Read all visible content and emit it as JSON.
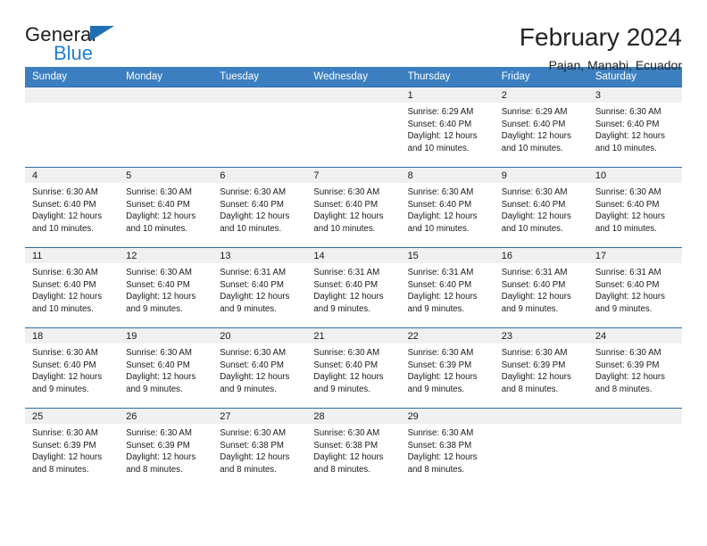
{
  "brand": {
    "name_part1": "General",
    "name_part2": "Blue",
    "triangle_color": "#1f6fb5",
    "blue_color": "#1f7fd0"
  },
  "header": {
    "title": "February 2024",
    "subtitle": "Pajan, Manabi, Ecuador"
  },
  "theme": {
    "header_row_bg": "#3c7fc1",
    "cell_border": "#2d6ca8",
    "daynum_band_bg": "#f0f0f0"
  },
  "weekdays": [
    "Sunday",
    "Monday",
    "Tuesday",
    "Wednesday",
    "Thursday",
    "Friday",
    "Saturday"
  ],
  "labels": {
    "sunrise_prefix": "Sunrise:",
    "sunset_prefix": "Sunset:",
    "daylight_prefix": "Daylight:"
  },
  "weeks": [
    [
      {
        "day": "",
        "empty": true
      },
      {
        "day": "",
        "empty": true
      },
      {
        "day": "",
        "empty": true
      },
      {
        "day": "",
        "empty": true
      },
      {
        "day": "1",
        "sunrise": "Sunrise: 6:29 AM",
        "sunset": "Sunset: 6:40 PM",
        "daylight1": "Daylight: 12 hours",
        "daylight2": "and 10 minutes."
      },
      {
        "day": "2",
        "sunrise": "Sunrise: 6:29 AM",
        "sunset": "Sunset: 6:40 PM",
        "daylight1": "Daylight: 12 hours",
        "daylight2": "and 10 minutes."
      },
      {
        "day": "3",
        "sunrise": "Sunrise: 6:30 AM",
        "sunset": "Sunset: 6:40 PM",
        "daylight1": "Daylight: 12 hours",
        "daylight2": "and 10 minutes."
      }
    ],
    [
      {
        "day": "4",
        "sunrise": "Sunrise: 6:30 AM",
        "sunset": "Sunset: 6:40 PM",
        "daylight1": "Daylight: 12 hours",
        "daylight2": "and 10 minutes."
      },
      {
        "day": "5",
        "sunrise": "Sunrise: 6:30 AM",
        "sunset": "Sunset: 6:40 PM",
        "daylight1": "Daylight: 12 hours",
        "daylight2": "and 10 minutes."
      },
      {
        "day": "6",
        "sunrise": "Sunrise: 6:30 AM",
        "sunset": "Sunset: 6:40 PM",
        "daylight1": "Daylight: 12 hours",
        "daylight2": "and 10 minutes."
      },
      {
        "day": "7",
        "sunrise": "Sunrise: 6:30 AM",
        "sunset": "Sunset: 6:40 PM",
        "daylight1": "Daylight: 12 hours",
        "daylight2": "and 10 minutes."
      },
      {
        "day": "8",
        "sunrise": "Sunrise: 6:30 AM",
        "sunset": "Sunset: 6:40 PM",
        "daylight1": "Daylight: 12 hours",
        "daylight2": "and 10 minutes."
      },
      {
        "day": "9",
        "sunrise": "Sunrise: 6:30 AM",
        "sunset": "Sunset: 6:40 PM",
        "daylight1": "Daylight: 12 hours",
        "daylight2": "and 10 minutes."
      },
      {
        "day": "10",
        "sunrise": "Sunrise: 6:30 AM",
        "sunset": "Sunset: 6:40 PM",
        "daylight1": "Daylight: 12 hours",
        "daylight2": "and 10 minutes."
      }
    ],
    [
      {
        "day": "11",
        "sunrise": "Sunrise: 6:30 AM",
        "sunset": "Sunset: 6:40 PM",
        "daylight1": "Daylight: 12 hours",
        "daylight2": "and 10 minutes."
      },
      {
        "day": "12",
        "sunrise": "Sunrise: 6:30 AM",
        "sunset": "Sunset: 6:40 PM",
        "daylight1": "Daylight: 12 hours",
        "daylight2": "and 9 minutes."
      },
      {
        "day": "13",
        "sunrise": "Sunrise: 6:31 AM",
        "sunset": "Sunset: 6:40 PM",
        "daylight1": "Daylight: 12 hours",
        "daylight2": "and 9 minutes."
      },
      {
        "day": "14",
        "sunrise": "Sunrise: 6:31 AM",
        "sunset": "Sunset: 6:40 PM",
        "daylight1": "Daylight: 12 hours",
        "daylight2": "and 9 minutes."
      },
      {
        "day": "15",
        "sunrise": "Sunrise: 6:31 AM",
        "sunset": "Sunset: 6:40 PM",
        "daylight1": "Daylight: 12 hours",
        "daylight2": "and 9 minutes."
      },
      {
        "day": "16",
        "sunrise": "Sunrise: 6:31 AM",
        "sunset": "Sunset: 6:40 PM",
        "daylight1": "Daylight: 12 hours",
        "daylight2": "and 9 minutes."
      },
      {
        "day": "17",
        "sunrise": "Sunrise: 6:31 AM",
        "sunset": "Sunset: 6:40 PM",
        "daylight1": "Daylight: 12 hours",
        "daylight2": "and 9 minutes."
      }
    ],
    [
      {
        "day": "18",
        "sunrise": "Sunrise: 6:30 AM",
        "sunset": "Sunset: 6:40 PM",
        "daylight1": "Daylight: 12 hours",
        "daylight2": "and 9 minutes."
      },
      {
        "day": "19",
        "sunrise": "Sunrise: 6:30 AM",
        "sunset": "Sunset: 6:40 PM",
        "daylight1": "Daylight: 12 hours",
        "daylight2": "and 9 minutes."
      },
      {
        "day": "20",
        "sunrise": "Sunrise: 6:30 AM",
        "sunset": "Sunset: 6:40 PM",
        "daylight1": "Daylight: 12 hours",
        "daylight2": "and 9 minutes."
      },
      {
        "day": "21",
        "sunrise": "Sunrise: 6:30 AM",
        "sunset": "Sunset: 6:40 PM",
        "daylight1": "Daylight: 12 hours",
        "daylight2": "and 9 minutes."
      },
      {
        "day": "22",
        "sunrise": "Sunrise: 6:30 AM",
        "sunset": "Sunset: 6:39 PM",
        "daylight1": "Daylight: 12 hours",
        "daylight2": "and 9 minutes."
      },
      {
        "day": "23",
        "sunrise": "Sunrise: 6:30 AM",
        "sunset": "Sunset: 6:39 PM",
        "daylight1": "Daylight: 12 hours",
        "daylight2": "and 8 minutes."
      },
      {
        "day": "24",
        "sunrise": "Sunrise: 6:30 AM",
        "sunset": "Sunset: 6:39 PM",
        "daylight1": "Daylight: 12 hours",
        "daylight2": "and 8 minutes."
      }
    ],
    [
      {
        "day": "25",
        "sunrise": "Sunrise: 6:30 AM",
        "sunset": "Sunset: 6:39 PM",
        "daylight1": "Daylight: 12 hours",
        "daylight2": "and 8 minutes."
      },
      {
        "day": "26",
        "sunrise": "Sunrise: 6:30 AM",
        "sunset": "Sunset: 6:39 PM",
        "daylight1": "Daylight: 12 hours",
        "daylight2": "and 8 minutes."
      },
      {
        "day": "27",
        "sunrise": "Sunrise: 6:30 AM",
        "sunset": "Sunset: 6:38 PM",
        "daylight1": "Daylight: 12 hours",
        "daylight2": "and 8 minutes."
      },
      {
        "day": "28",
        "sunrise": "Sunrise: 6:30 AM",
        "sunset": "Sunset: 6:38 PM",
        "daylight1": "Daylight: 12 hours",
        "daylight2": "and 8 minutes."
      },
      {
        "day": "29",
        "sunrise": "Sunrise: 6:30 AM",
        "sunset": "Sunset: 6:38 PM",
        "daylight1": "Daylight: 12 hours",
        "daylight2": "and 8 minutes."
      },
      {
        "day": "",
        "empty": true
      },
      {
        "day": "",
        "empty": true
      }
    ]
  ]
}
